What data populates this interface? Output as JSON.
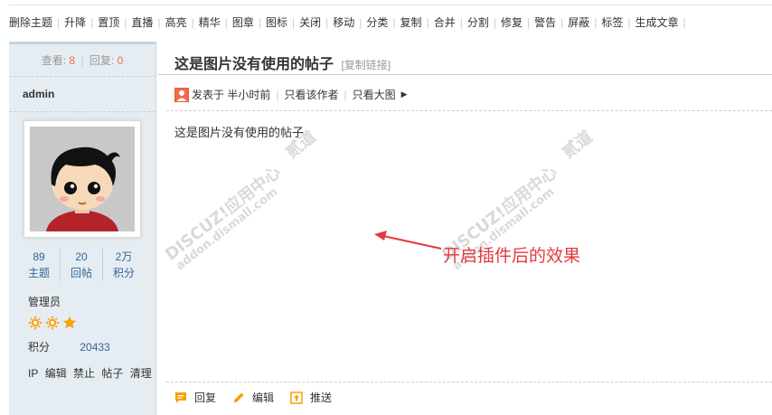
{
  "toolbar": {
    "items": [
      "删除主题",
      "升降",
      "置顶",
      "直播",
      "高亮",
      "精华",
      "图章",
      "图标",
      "关闭",
      "移动",
      "分类",
      "复制",
      "合并",
      "分割",
      "修复",
      "警告",
      "屏蔽",
      "标签",
      "生成文章"
    ]
  },
  "sidebar": {
    "views_label": "查看:",
    "views": "8",
    "replies_label": "回复:",
    "replies": "0",
    "username": "admin",
    "counts": [
      {
        "value": "89",
        "label": "主题"
      },
      {
        "value": "20",
        "label": "回帖"
      },
      {
        "value": "2万",
        "label": "积分"
      }
    ],
    "rank": "管理员",
    "score_label": "积分",
    "score_value": "20433",
    "actions": [
      "IP",
      "编辑",
      "禁止",
      "帖子",
      "清理"
    ]
  },
  "post": {
    "title": "这是图片没有使用的帖子",
    "copy_link": "[复制链接]",
    "posted": "发表于 半小时前",
    "only_author": "只看该作者",
    "large_image": "只看大图",
    "content": "这是图片没有使用的帖子",
    "annotation": "开启插件后的效果"
  },
  "footer": {
    "reply": "回复",
    "edit": "编辑",
    "push": "推送"
  },
  "watermark": {
    "brand": "DISCUZ!应用中心",
    "site": "addon.dismall.com",
    "mark": "贰道"
  },
  "colors": {
    "sidebar_bg": "#e5edf2",
    "border": "#c2d5e3",
    "link": "#336699",
    "accent": "#f26c4f",
    "annotation": "#e4393c",
    "star": "#f8a000"
  }
}
